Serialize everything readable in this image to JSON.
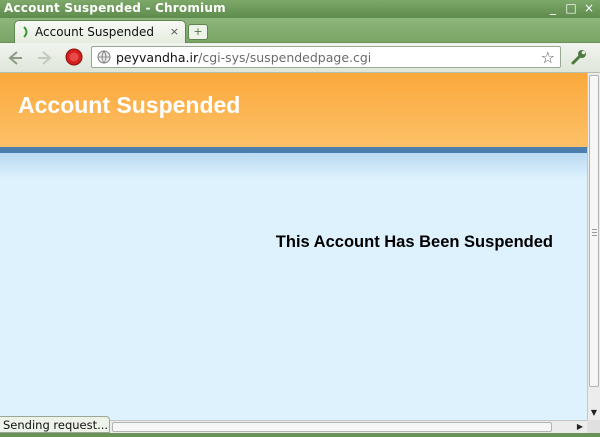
{
  "window": {
    "title": "Account Suspended - Chromium",
    "controls": {
      "minimize": "_",
      "maximize": "□",
      "close": "×"
    }
  },
  "tab": {
    "title": "Account Suspended",
    "close_glyph": "×",
    "new_tab_glyph": "+"
  },
  "omnibox": {
    "host": "peyvandha.ir",
    "path": "/cgi-sys/suspendedpage.cgi",
    "star_glyph": "☆"
  },
  "page": {
    "heading": "Account Suspended",
    "message": "This Account Has Been Suspended"
  },
  "status": {
    "text": "Sending request..."
  },
  "scrollbars": {
    "up_glyph": "▲",
    "down_glyph": "▼",
    "right_glyph": "▶"
  },
  "colors": {
    "header_orange": "#fba83b",
    "page_bg": "#def2fd",
    "bar_blue": "#4c7fad",
    "stop_red": "#d41f1f"
  }
}
